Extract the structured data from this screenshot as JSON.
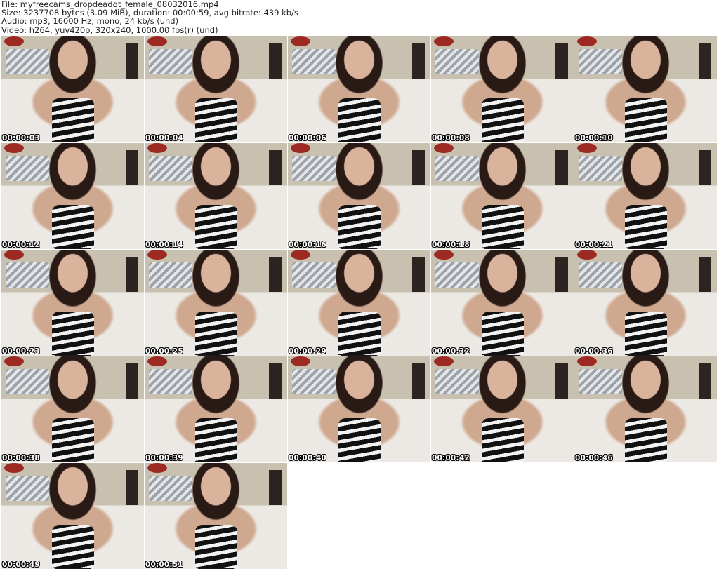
{
  "info": {
    "file": "File: myfreecams_dropdeadqt_female_08032016.mp4",
    "size": "Size: 3237708 bytes (3.09 MiB), duration: 00:00:59, avg.bitrate: 439 kb/s",
    "audio": "Audio: mp3, 16000 Hz, mono, 24 kb/s (und)",
    "video": "Video: h264, yuv420p, 320x240, 1000.00 fps(r) (und)"
  },
  "thumbnails": [
    {
      "timestamp": "00:00:03"
    },
    {
      "timestamp": "00:00:04"
    },
    {
      "timestamp": "00:00:06"
    },
    {
      "timestamp": "00:00:08"
    },
    {
      "timestamp": "00:00:10"
    },
    {
      "timestamp": "00:00:12"
    },
    {
      "timestamp": "00:00:14"
    },
    {
      "timestamp": "00:00:16"
    },
    {
      "timestamp": "00:00:18"
    },
    {
      "timestamp": "00:00:21"
    },
    {
      "timestamp": "00:00:23"
    },
    {
      "timestamp": "00:00:25"
    },
    {
      "timestamp": "00:00:29"
    },
    {
      "timestamp": "00:00:32"
    },
    {
      "timestamp": "00:00:36"
    },
    {
      "timestamp": "00:00:38"
    },
    {
      "timestamp": "00:00:39"
    },
    {
      "timestamp": "00:00:40"
    },
    {
      "timestamp": "00:00:42"
    },
    {
      "timestamp": "00:00:46"
    },
    {
      "timestamp": "00:00:49"
    },
    {
      "timestamp": "00:00:51"
    }
  ]
}
